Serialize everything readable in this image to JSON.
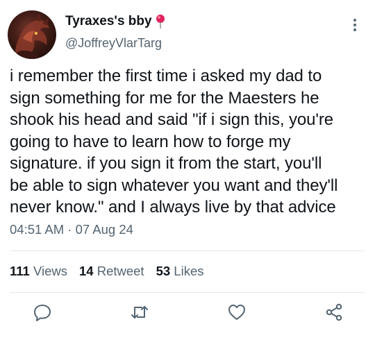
{
  "author": {
    "display_name": "Tyraxes's bby",
    "handle": "@JoffreyVlarTarg"
  },
  "tweet": {
    "lines": [
      "i remember the first time i asked my dad to",
      "sign something for me for the Maesters he",
      "shook his head and said \"if i sign this, you're",
      "going to have to learn how to forge my",
      "signature. if you sign it from the start, you'll",
      "be able to sign whatever you want and they'll",
      "never know.\" and I always live by that advice"
    ],
    "timestamp": "04:51 AM · 07 Aug 24"
  },
  "stats": {
    "views_count": "111",
    "views_label": "Views",
    "retweet_count": "14",
    "retweet_label": "Retweet",
    "likes_count": "53",
    "likes_label": "Likes"
  },
  "icons": {
    "name_emoji": "pushpin-icon",
    "more": "more-vertical-icon",
    "reply": "reply-icon",
    "retweet": "retweet-icon",
    "like": "heart-icon",
    "share": "share-icon"
  },
  "colors": {
    "text_primary": "#0f1419",
    "text_secondary": "#536471",
    "divider": "#e5e8eb",
    "pin_red": "#e0245e"
  }
}
